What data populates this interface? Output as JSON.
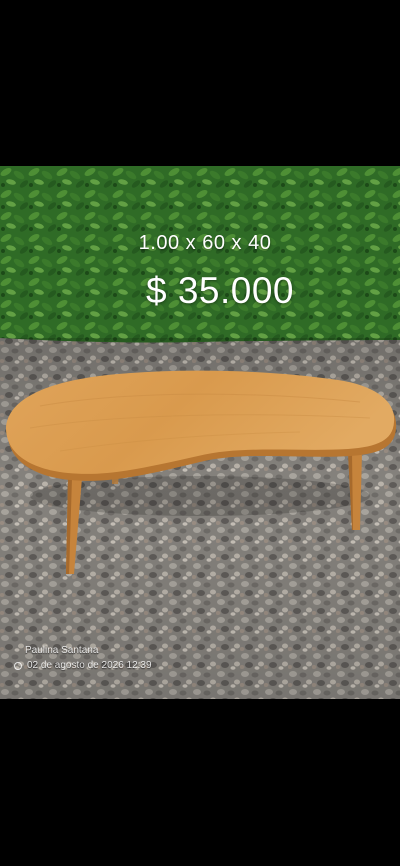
{
  "photo": {
    "subject": "kidney-shaped wooden coffee table",
    "overlay": {
      "dimensions": "1.00 x 60 x 40",
      "price": "$ 35.000"
    },
    "watermark": {
      "author": "Paulina Santana",
      "date": "02 de agosto de 2026 12:39"
    }
  },
  "colors": {
    "background": "#000000",
    "hedge": "#2f6b26",
    "gravel": "#8f8c86",
    "wood": "#d89a4e",
    "text": "#ffffff"
  }
}
